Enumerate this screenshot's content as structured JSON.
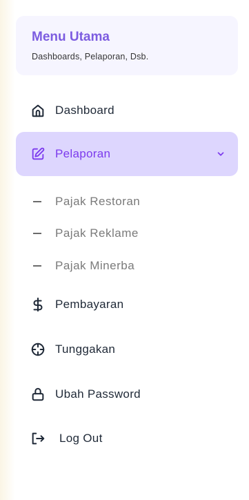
{
  "header": {
    "title": "Menu Utama",
    "subtitle": "Dashboards, Pelaporan, Dsb."
  },
  "menu": {
    "dashboard": {
      "label": "Dashboard",
      "icon": "home-icon"
    },
    "pelaporan": {
      "label": "Pelaporan",
      "icon": "edit-icon",
      "expanded": true,
      "submenu": [
        {
          "label": "Pajak Restoran"
        },
        {
          "label": "Pajak Reklame"
        },
        {
          "label": "Pajak Minerba"
        }
      ]
    },
    "pembayaran": {
      "label": "Pembayaran",
      "icon": "dollar-icon"
    },
    "tunggakan": {
      "label": "Tunggakan",
      "icon": "crosshair-icon"
    },
    "ubah_password": {
      "label": "Ubah Password",
      "icon": "lock-icon"
    },
    "logout": {
      "label": "Log Out",
      "icon": "logout-icon"
    }
  },
  "colors": {
    "accent": "#7c3aed",
    "active_bg": "#ddd6fe",
    "header_bg": "#f6f5ff",
    "text": "#1f2937"
  }
}
